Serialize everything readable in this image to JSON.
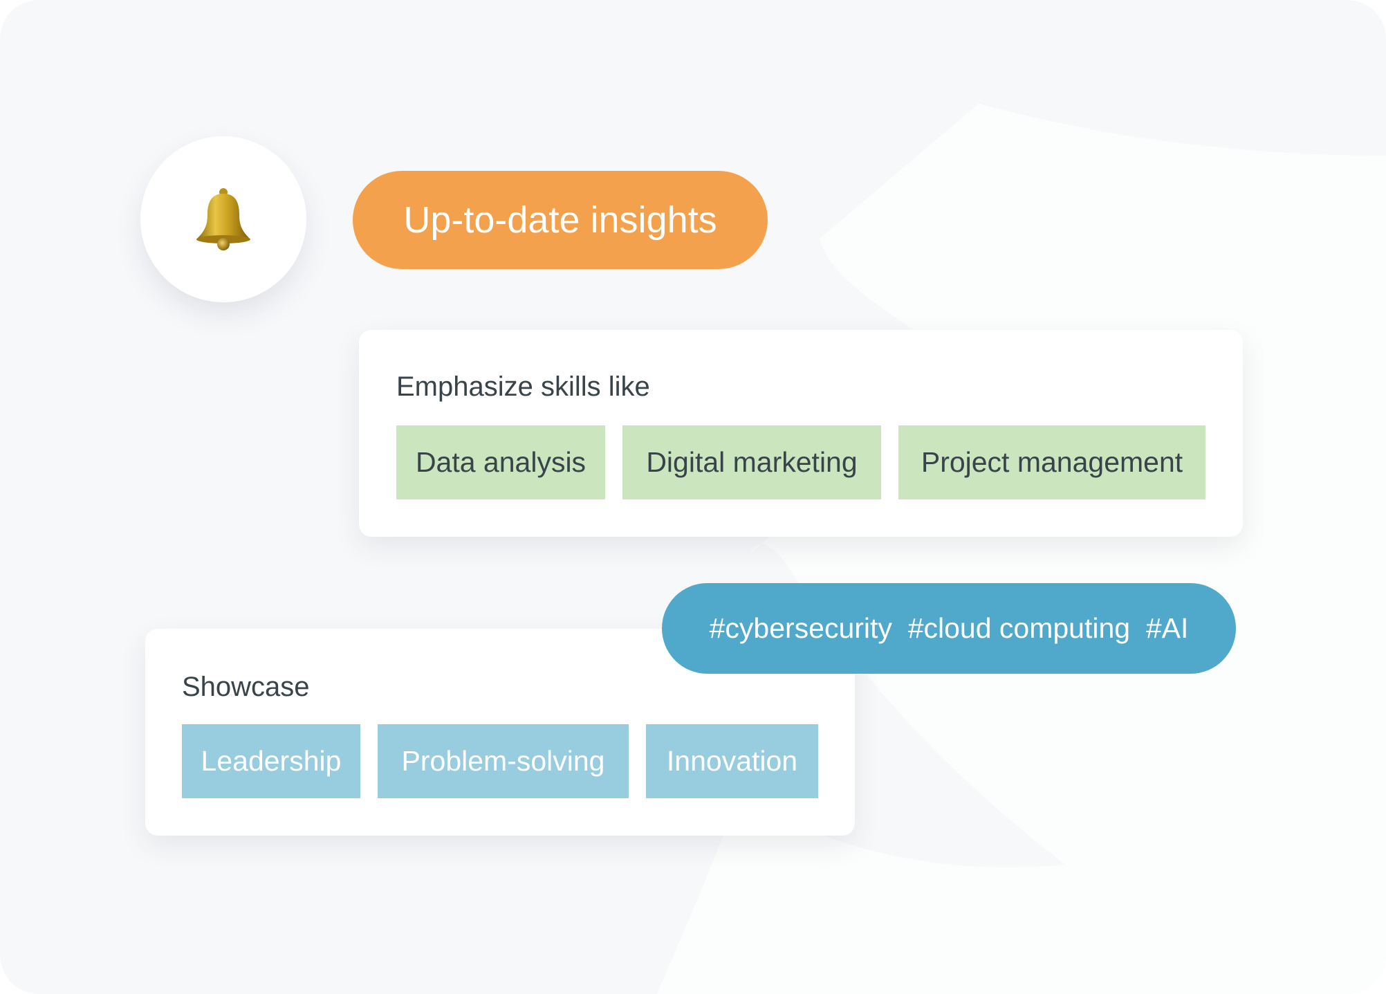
{
  "colors": {
    "background": "#f7f8fa",
    "accent_orange": "#f4a14d",
    "accent_blue": "#50a9ca",
    "chip_green": "#cbe6bf",
    "chip_blue": "#98cde0",
    "text_dark": "#38434a"
  },
  "notification": {
    "icon": "bell-icon",
    "badge_label": "Up-to-date insights"
  },
  "emphasize_card": {
    "title": "Emphasize skills like",
    "skills": [
      "Data analysis",
      "Digital marketing",
      "Project management"
    ]
  },
  "hashtags": {
    "label": "#cybersecurity  #cloud computing  #AI",
    "tags": [
      "#cybersecurity",
      "#cloud computing",
      "#AI"
    ]
  },
  "showcase_card": {
    "title": "Showcase",
    "skills": [
      "Leadership",
      "Problem-solving",
      "Innovation"
    ]
  }
}
